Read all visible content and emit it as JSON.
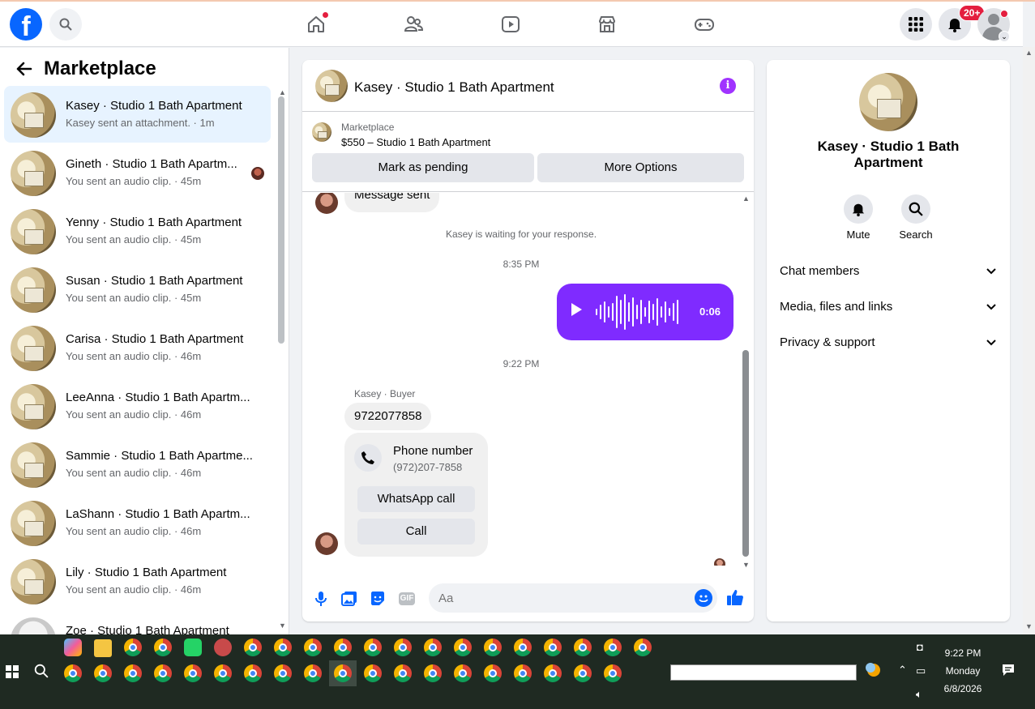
{
  "nav": {
    "logo": "f",
    "notif_badge": "20+"
  },
  "sidebar": {
    "title": "Marketplace",
    "items": [
      {
        "name": "Kasey · Studio 1 Bath Apartment",
        "sub": "Kasey sent an attachment. · 1m"
      },
      {
        "name": "Gineth · Studio 1 Bath Apartm...",
        "sub": "You sent an audio clip. · 45m"
      },
      {
        "name": "Yenny · Studio 1 Bath Apartment",
        "sub": "You sent an audio clip. · 45m"
      },
      {
        "name": "Susan · Studio 1 Bath Apartment",
        "sub": "You sent an audio clip. · 45m"
      },
      {
        "name": "Carisa · Studio 1 Bath Apartment",
        "sub": "You sent an audio clip. · 46m"
      },
      {
        "name": "LeeAnna · Studio 1 Bath Apartm...",
        "sub": "You sent an audio clip. · 46m"
      },
      {
        "name": "Sammie · Studio 1 Bath Apartme...",
        "sub": "You sent an audio clip. · 46m"
      },
      {
        "name": "LaShann · Studio 1 Bath Apartm...",
        "sub": "You sent an audio clip. · 46m"
      },
      {
        "name": "Lily · Studio 1 Bath Apartment",
        "sub": "You sent an audio clip. · 46m"
      },
      {
        "name": "Zoe · Studio 1 Bath Apartment",
        "sub": ""
      }
    ]
  },
  "chat": {
    "title": "Kasey · Studio 1 Bath Apartment",
    "listing_label": "Marketplace",
    "listing_price": "$550 – Studio 1 Bath Apartment",
    "btn_pending": "Mark as pending",
    "btn_more": "More Options",
    "msg_sent": "Message sent",
    "waiting": "Kasey is waiting for your response.",
    "time1": "8:35 PM",
    "audio_duration": "0:06",
    "time2": "9:22 PM",
    "sender": "Kasey · Buyer",
    "phone_msg": "9722077858",
    "phone_title": "Phone number",
    "phone_formatted": "(972)207-7858",
    "whatsapp": "WhatsApp call",
    "call": "Call",
    "composer_placeholder": "Aa",
    "gif": "GIF"
  },
  "details": {
    "title": "Kasey · Studio 1 Bath Apartment",
    "mute": "Mute",
    "search": "Search",
    "sections": [
      "Chat members",
      "Media, files and links",
      "Privacy & support"
    ]
  },
  "taskbar": {
    "time": "9:22 PM",
    "day": "Monday",
    "date": "6/8/2026"
  },
  "colors": {
    "accent_blue": "#0866ff",
    "audio_purple": "#7f2bff",
    "info_purple": "#a033ff",
    "badge_red": "#e41e3f"
  }
}
